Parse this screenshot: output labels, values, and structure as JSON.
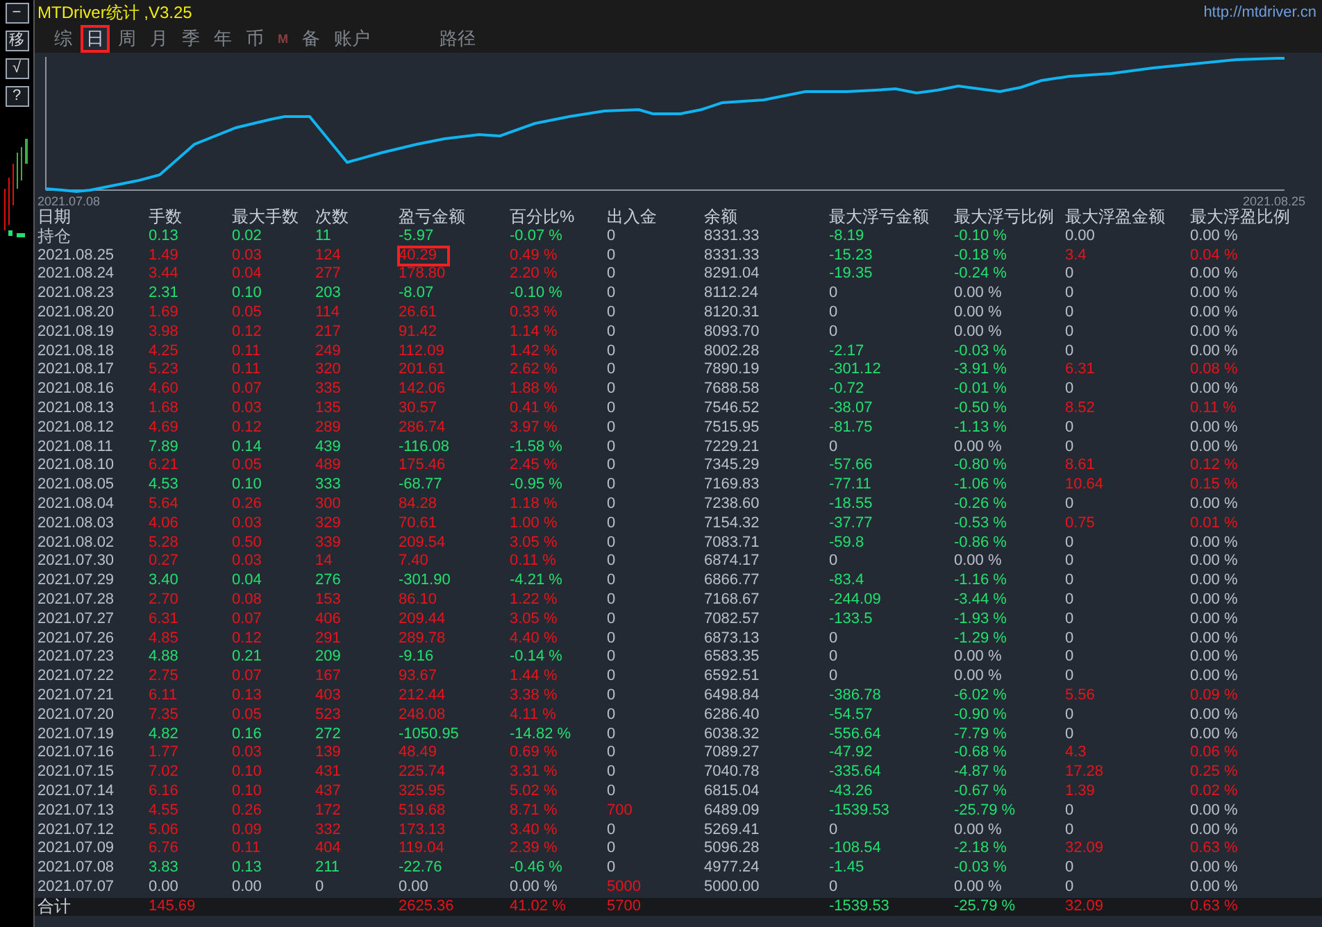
{
  "window": {
    "title": "MTDriver统计 ,V3.25",
    "url": "http://mtdriver.cn"
  },
  "sidebar": {
    "buttons": [
      "−",
      "移",
      "√",
      "?"
    ]
  },
  "tabs": [
    {
      "label": "综",
      "kind": "tab",
      "selected": false
    },
    {
      "label": "日",
      "kind": "tab",
      "selected": true
    },
    {
      "label": "周",
      "kind": "tab",
      "selected": false
    },
    {
      "label": "月",
      "kind": "tab",
      "selected": false
    },
    {
      "label": "季",
      "kind": "tab",
      "selected": false
    },
    {
      "label": "年",
      "kind": "tab",
      "selected": false
    },
    {
      "label": "币",
      "kind": "tab",
      "selected": false
    },
    {
      "label": "M",
      "kind": "mark",
      "selected": false
    },
    {
      "label": "备",
      "kind": "tab",
      "selected": false
    },
    {
      "label": "账户",
      "kind": "tab",
      "selected": false
    },
    {
      "label": "路径",
      "kind": "link",
      "selected": false
    }
  ],
  "chart": {
    "start_label": "2021.07.08",
    "end_label": "2021.08.25"
  },
  "table": {
    "date_column": "日期",
    "columns": [
      "手数",
      "最大手数",
      "次数",
      "盈亏金额",
      "百分比%",
      "出入金",
      "余额",
      "最大浮亏金额",
      "最大浮亏比例",
      "最大浮盈金额",
      "最大浮盈比例"
    ],
    "rows": [
      {
        "date": "持仓",
        "cells": [
          {
            "text": "0.13",
            "color": "#22e06e"
          },
          {
            "text": "0.02",
            "color": "#22e06e"
          },
          {
            "text": "11",
            "color": "#22e06e"
          },
          {
            "text": "-5.97",
            "color": "#22e06e"
          },
          {
            "text": "-0.07 %",
            "color": "#22e06e"
          },
          {
            "text": "0",
            "color": "#b8c0cc"
          },
          {
            "text": "8331.33",
            "color": "#b8c0cc"
          },
          {
            "text": "-8.19",
            "color": "#22e06e"
          },
          {
            "text": "-0.10 %",
            "color": "#22e06e"
          },
          {
            "text": "0.00",
            "color": "#b8c0cc"
          },
          {
            "text": "0.00 %",
            "color": "#b8c0cc"
          }
        ]
      },
      {
        "date": "2021.08.25",
        "cells": [
          {
            "text": "1.49",
            "color": "#e8141c"
          },
          {
            "text": "0.03",
            "color": "#e8141c"
          },
          {
            "text": "124",
            "color": "#e8141c"
          },
          {
            "text": "40.29",
            "color": "#e8141c",
            "outlined": true
          },
          {
            "text": "0.49 %",
            "color": "#e8141c"
          },
          {
            "text": "0",
            "color": "#b8c0cc"
          },
          {
            "text": "8331.33",
            "color": "#b8c0cc"
          },
          {
            "text": "-15.23",
            "color": "#22e06e"
          },
          {
            "text": "-0.18 %",
            "color": "#22e06e"
          },
          {
            "text": "3.4",
            "color": "#e8141c"
          },
          {
            "text": "0.04 %",
            "color": "#e8141c"
          }
        ]
      },
      {
        "date": "2021.08.24",
        "cells": [
          {
            "text": "3.44",
            "color": "#e8141c"
          },
          {
            "text": "0.04",
            "color": "#e8141c"
          },
          {
            "text": "277",
            "color": "#e8141c"
          },
          {
            "text": "178.80",
            "color": "#e8141c"
          },
          {
            "text": "2.20 %",
            "color": "#e8141c"
          },
          {
            "text": "0",
            "color": "#b8c0cc"
          },
          {
            "text": "8291.04",
            "color": "#b8c0cc"
          },
          {
            "text": "-19.35",
            "color": "#22e06e"
          },
          {
            "text": "-0.24 %",
            "color": "#22e06e"
          },
          {
            "text": "0",
            "color": "#b8c0cc"
          },
          {
            "text": "0.00 %",
            "color": "#b8c0cc"
          }
        ]
      },
      {
        "date": "2021.08.23",
        "cells": [
          {
            "text": "2.31",
            "color": "#22e06e"
          },
          {
            "text": "0.10",
            "color": "#22e06e"
          },
          {
            "text": "203",
            "color": "#22e06e"
          },
          {
            "text": "-8.07",
            "color": "#22e06e"
          },
          {
            "text": "-0.10 %",
            "color": "#22e06e"
          },
          {
            "text": "0",
            "color": "#b8c0cc"
          },
          {
            "text": "8112.24",
            "color": "#b8c0cc"
          },
          {
            "text": "0",
            "color": "#b8c0cc"
          },
          {
            "text": "0.00 %",
            "color": "#b8c0cc"
          },
          {
            "text": "0",
            "color": "#b8c0cc"
          },
          {
            "text": "0.00 %",
            "color": "#b8c0cc"
          }
        ]
      },
      {
        "date": "2021.08.20",
        "cells": [
          {
            "text": "1.69",
            "color": "#e8141c"
          },
          {
            "text": "0.05",
            "color": "#e8141c"
          },
          {
            "text": "114",
            "color": "#e8141c"
          },
          {
            "text": "26.61",
            "color": "#e8141c"
          },
          {
            "text": "0.33 %",
            "color": "#e8141c"
          },
          {
            "text": "0",
            "color": "#b8c0cc"
          },
          {
            "text": "8120.31",
            "color": "#b8c0cc"
          },
          {
            "text": "0",
            "color": "#b8c0cc"
          },
          {
            "text": "0.00 %",
            "color": "#b8c0cc"
          },
          {
            "text": "0",
            "color": "#b8c0cc"
          },
          {
            "text": "0.00 %",
            "color": "#b8c0cc"
          }
        ]
      },
      {
        "date": "2021.08.19",
        "cells": [
          {
            "text": "3.98",
            "color": "#e8141c"
          },
          {
            "text": "0.12",
            "color": "#e8141c"
          },
          {
            "text": "217",
            "color": "#e8141c"
          },
          {
            "text": "91.42",
            "color": "#e8141c"
          },
          {
            "text": "1.14 %",
            "color": "#e8141c"
          },
          {
            "text": "0",
            "color": "#b8c0cc"
          },
          {
            "text": "8093.70",
            "color": "#b8c0cc"
          },
          {
            "text": "0",
            "color": "#b8c0cc"
          },
          {
            "text": "0.00 %",
            "color": "#b8c0cc"
          },
          {
            "text": "0",
            "color": "#b8c0cc"
          },
          {
            "text": "0.00 %",
            "color": "#b8c0cc"
          }
        ]
      },
      {
        "date": "2021.08.18",
        "cells": [
          {
            "text": "4.25",
            "color": "#e8141c"
          },
          {
            "text": "0.11",
            "color": "#e8141c"
          },
          {
            "text": "249",
            "color": "#e8141c"
          },
          {
            "text": "112.09",
            "color": "#e8141c"
          },
          {
            "text": "1.42 %",
            "color": "#e8141c"
          },
          {
            "text": "0",
            "color": "#b8c0cc"
          },
          {
            "text": "8002.28",
            "color": "#b8c0cc"
          },
          {
            "text": "-2.17",
            "color": "#22e06e"
          },
          {
            "text": "-0.03 %",
            "color": "#22e06e"
          },
          {
            "text": "0",
            "color": "#b8c0cc"
          },
          {
            "text": "0.00 %",
            "color": "#b8c0cc"
          }
        ]
      },
      {
        "date": "2021.08.17",
        "cells": [
          {
            "text": "5.23",
            "color": "#e8141c"
          },
          {
            "text": "0.11",
            "color": "#e8141c"
          },
          {
            "text": "320",
            "color": "#e8141c"
          },
          {
            "text": "201.61",
            "color": "#e8141c"
          },
          {
            "text": "2.62 %",
            "color": "#e8141c"
          },
          {
            "text": "0",
            "color": "#b8c0cc"
          },
          {
            "text": "7890.19",
            "color": "#b8c0cc"
          },
          {
            "text": "-301.12",
            "color": "#22e06e"
          },
          {
            "text": "-3.91 %",
            "color": "#22e06e"
          },
          {
            "text": "6.31",
            "color": "#e8141c"
          },
          {
            "text": "0.08 %",
            "color": "#e8141c"
          }
        ]
      },
      {
        "date": "2021.08.16",
        "cells": [
          {
            "text": "4.60",
            "color": "#e8141c"
          },
          {
            "text": "0.07",
            "color": "#e8141c"
          },
          {
            "text": "335",
            "color": "#e8141c"
          },
          {
            "text": "142.06",
            "color": "#e8141c"
          },
          {
            "text": "1.88 %",
            "color": "#e8141c"
          },
          {
            "text": "0",
            "color": "#b8c0cc"
          },
          {
            "text": "7688.58",
            "color": "#b8c0cc"
          },
          {
            "text": "-0.72",
            "color": "#22e06e"
          },
          {
            "text": "-0.01 %",
            "color": "#22e06e"
          },
          {
            "text": "0",
            "color": "#b8c0cc"
          },
          {
            "text": "0.00 %",
            "color": "#b8c0cc"
          }
        ]
      },
      {
        "date": "2021.08.13",
        "cells": [
          {
            "text": "1.68",
            "color": "#e8141c"
          },
          {
            "text": "0.03",
            "color": "#e8141c"
          },
          {
            "text": "135",
            "color": "#e8141c"
          },
          {
            "text": "30.57",
            "color": "#e8141c"
          },
          {
            "text": "0.41 %",
            "color": "#e8141c"
          },
          {
            "text": "0",
            "color": "#b8c0cc"
          },
          {
            "text": "7546.52",
            "color": "#b8c0cc"
          },
          {
            "text": "-38.07",
            "color": "#22e06e"
          },
          {
            "text": "-0.50 %",
            "color": "#22e06e"
          },
          {
            "text": "8.52",
            "color": "#e8141c"
          },
          {
            "text": "0.11 %",
            "color": "#e8141c"
          }
        ]
      },
      {
        "date": "2021.08.12",
        "cells": [
          {
            "text": "4.69",
            "color": "#e8141c"
          },
          {
            "text": "0.12",
            "color": "#e8141c"
          },
          {
            "text": "289",
            "color": "#e8141c"
          },
          {
            "text": "286.74",
            "color": "#e8141c"
          },
          {
            "text": "3.97 %",
            "color": "#e8141c"
          },
          {
            "text": "0",
            "color": "#b8c0cc"
          },
          {
            "text": "7515.95",
            "color": "#b8c0cc"
          },
          {
            "text": "-81.75",
            "color": "#22e06e"
          },
          {
            "text": "-1.13 %",
            "color": "#22e06e"
          },
          {
            "text": "0",
            "color": "#b8c0cc"
          },
          {
            "text": "0.00 %",
            "color": "#b8c0cc"
          }
        ]
      },
      {
        "date": "2021.08.11",
        "cells": [
          {
            "text": "7.89",
            "color": "#22e06e"
          },
          {
            "text": "0.14",
            "color": "#22e06e"
          },
          {
            "text": "439",
            "color": "#22e06e"
          },
          {
            "text": "-116.08",
            "color": "#22e06e"
          },
          {
            "text": "-1.58 %",
            "color": "#22e06e"
          },
          {
            "text": "0",
            "color": "#b8c0cc"
          },
          {
            "text": "7229.21",
            "color": "#b8c0cc"
          },
          {
            "text": "0",
            "color": "#b8c0cc"
          },
          {
            "text": "0.00 %",
            "color": "#b8c0cc"
          },
          {
            "text": "0",
            "color": "#b8c0cc"
          },
          {
            "text": "0.00 %",
            "color": "#b8c0cc"
          }
        ]
      },
      {
        "date": "2021.08.10",
        "cells": [
          {
            "text": "6.21",
            "color": "#e8141c"
          },
          {
            "text": "0.05",
            "color": "#e8141c"
          },
          {
            "text": "489",
            "color": "#e8141c"
          },
          {
            "text": "175.46",
            "color": "#e8141c"
          },
          {
            "text": "2.45 %",
            "color": "#e8141c"
          },
          {
            "text": "0",
            "color": "#b8c0cc"
          },
          {
            "text": "7345.29",
            "color": "#b8c0cc"
          },
          {
            "text": "-57.66",
            "color": "#22e06e"
          },
          {
            "text": "-0.80 %",
            "color": "#22e06e"
          },
          {
            "text": "8.61",
            "color": "#e8141c"
          },
          {
            "text": "0.12 %",
            "color": "#e8141c"
          }
        ]
      },
      {
        "date": "2021.08.05",
        "cells": [
          {
            "text": "4.53",
            "color": "#22e06e"
          },
          {
            "text": "0.10",
            "color": "#22e06e"
          },
          {
            "text": "333",
            "color": "#22e06e"
          },
          {
            "text": "-68.77",
            "color": "#22e06e"
          },
          {
            "text": "-0.95 %",
            "color": "#22e06e"
          },
          {
            "text": "0",
            "color": "#b8c0cc"
          },
          {
            "text": "7169.83",
            "color": "#b8c0cc"
          },
          {
            "text": "-77.11",
            "color": "#22e06e"
          },
          {
            "text": "-1.06 %",
            "color": "#22e06e"
          },
          {
            "text": "10.64",
            "color": "#e8141c"
          },
          {
            "text": "0.15 %",
            "color": "#e8141c"
          }
        ]
      },
      {
        "date": "2021.08.04",
        "cells": [
          {
            "text": "5.64",
            "color": "#e8141c"
          },
          {
            "text": "0.26",
            "color": "#e8141c"
          },
          {
            "text": "300",
            "color": "#e8141c"
          },
          {
            "text": "84.28",
            "color": "#e8141c"
          },
          {
            "text": "1.18 %",
            "color": "#e8141c"
          },
          {
            "text": "0",
            "color": "#b8c0cc"
          },
          {
            "text": "7238.60",
            "color": "#b8c0cc"
          },
          {
            "text": "-18.55",
            "color": "#22e06e"
          },
          {
            "text": "-0.26 %",
            "color": "#22e06e"
          },
          {
            "text": "0",
            "color": "#b8c0cc"
          },
          {
            "text": "0.00 %",
            "color": "#b8c0cc"
          }
        ]
      },
      {
        "date": "2021.08.03",
        "cells": [
          {
            "text": "4.06",
            "color": "#e8141c"
          },
          {
            "text": "0.03",
            "color": "#e8141c"
          },
          {
            "text": "329",
            "color": "#e8141c"
          },
          {
            "text": "70.61",
            "color": "#e8141c"
          },
          {
            "text": "1.00 %",
            "color": "#e8141c"
          },
          {
            "text": "0",
            "color": "#b8c0cc"
          },
          {
            "text": "7154.32",
            "color": "#b8c0cc"
          },
          {
            "text": "-37.77",
            "color": "#22e06e"
          },
          {
            "text": "-0.53 %",
            "color": "#22e06e"
          },
          {
            "text": "0.75",
            "color": "#e8141c"
          },
          {
            "text": "0.01 %",
            "color": "#e8141c"
          }
        ]
      },
      {
        "date": "2021.08.02",
        "cells": [
          {
            "text": "5.28",
            "color": "#e8141c"
          },
          {
            "text": "0.50",
            "color": "#e8141c"
          },
          {
            "text": "339",
            "color": "#e8141c"
          },
          {
            "text": "209.54",
            "color": "#e8141c"
          },
          {
            "text": "3.05 %",
            "color": "#e8141c"
          },
          {
            "text": "0",
            "color": "#b8c0cc"
          },
          {
            "text": "7083.71",
            "color": "#b8c0cc"
          },
          {
            "text": "-59.8",
            "color": "#22e06e"
          },
          {
            "text": "-0.86 %",
            "color": "#22e06e"
          },
          {
            "text": "0",
            "color": "#b8c0cc"
          },
          {
            "text": "0.00 %",
            "color": "#b8c0cc"
          }
        ]
      },
      {
        "date": "2021.07.30",
        "cells": [
          {
            "text": "0.27",
            "color": "#e8141c"
          },
          {
            "text": "0.03",
            "color": "#e8141c"
          },
          {
            "text": "14",
            "color": "#e8141c"
          },
          {
            "text": "7.40",
            "color": "#e8141c"
          },
          {
            "text": "0.11 %",
            "color": "#e8141c"
          },
          {
            "text": "0",
            "color": "#b8c0cc"
          },
          {
            "text": "6874.17",
            "color": "#b8c0cc"
          },
          {
            "text": "0",
            "color": "#b8c0cc"
          },
          {
            "text": "0.00 %",
            "color": "#b8c0cc"
          },
          {
            "text": "0",
            "color": "#b8c0cc"
          },
          {
            "text": "0.00 %",
            "color": "#b8c0cc"
          }
        ]
      },
      {
        "date": "2021.07.29",
        "cells": [
          {
            "text": "3.40",
            "color": "#22e06e"
          },
          {
            "text": "0.04",
            "color": "#22e06e"
          },
          {
            "text": "276",
            "color": "#22e06e"
          },
          {
            "text": "-301.90",
            "color": "#22e06e"
          },
          {
            "text": "-4.21 %",
            "color": "#22e06e"
          },
          {
            "text": "0",
            "color": "#b8c0cc"
          },
          {
            "text": "6866.77",
            "color": "#b8c0cc"
          },
          {
            "text": "-83.4",
            "color": "#22e06e"
          },
          {
            "text": "-1.16 %",
            "color": "#22e06e"
          },
          {
            "text": "0",
            "color": "#b8c0cc"
          },
          {
            "text": "0.00 %",
            "color": "#b8c0cc"
          }
        ]
      },
      {
        "date": "2021.07.28",
        "cells": [
          {
            "text": "2.70",
            "color": "#e8141c"
          },
          {
            "text": "0.08",
            "color": "#e8141c"
          },
          {
            "text": "153",
            "color": "#e8141c"
          },
          {
            "text": "86.10",
            "color": "#e8141c"
          },
          {
            "text": "1.22 %",
            "color": "#e8141c"
          },
          {
            "text": "0",
            "color": "#b8c0cc"
          },
          {
            "text": "7168.67",
            "color": "#b8c0cc"
          },
          {
            "text": "-244.09",
            "color": "#22e06e"
          },
          {
            "text": "-3.44 %",
            "color": "#22e06e"
          },
          {
            "text": "0",
            "color": "#b8c0cc"
          },
          {
            "text": "0.00 %",
            "color": "#b8c0cc"
          }
        ]
      },
      {
        "date": "2021.07.27",
        "cells": [
          {
            "text": "6.31",
            "color": "#e8141c"
          },
          {
            "text": "0.07",
            "color": "#e8141c"
          },
          {
            "text": "406",
            "color": "#e8141c"
          },
          {
            "text": "209.44",
            "color": "#e8141c"
          },
          {
            "text": "3.05 %",
            "color": "#e8141c"
          },
          {
            "text": "0",
            "color": "#b8c0cc"
          },
          {
            "text": "7082.57",
            "color": "#b8c0cc"
          },
          {
            "text": "-133.5",
            "color": "#22e06e"
          },
          {
            "text": "-1.93 %",
            "color": "#22e06e"
          },
          {
            "text": "0",
            "color": "#b8c0cc"
          },
          {
            "text": "0.00 %",
            "color": "#b8c0cc"
          }
        ]
      },
      {
        "date": "2021.07.26",
        "cells": [
          {
            "text": "4.85",
            "color": "#e8141c"
          },
          {
            "text": "0.12",
            "color": "#e8141c"
          },
          {
            "text": "291",
            "color": "#e8141c"
          },
          {
            "text": "289.78",
            "color": "#e8141c"
          },
          {
            "text": "4.40 %",
            "color": "#e8141c"
          },
          {
            "text": "0",
            "color": "#b8c0cc"
          },
          {
            "text": "6873.13",
            "color": "#b8c0cc"
          },
          {
            "text": "0",
            "color": "#b8c0cc"
          },
          {
            "text": "-1.29 %",
            "color": "#22e06e"
          },
          {
            "text": "0",
            "color": "#b8c0cc"
          },
          {
            "text": "0.00 %",
            "color": "#b8c0cc"
          }
        ]
      },
      {
        "date": "2021.07.23",
        "cells": [
          {
            "text": "4.88",
            "color": "#22e06e"
          },
          {
            "text": "0.21",
            "color": "#22e06e"
          },
          {
            "text": "209",
            "color": "#22e06e"
          },
          {
            "text": "-9.16",
            "color": "#22e06e"
          },
          {
            "text": "-0.14 %",
            "color": "#22e06e"
          },
          {
            "text": "0",
            "color": "#b8c0cc"
          },
          {
            "text": "6583.35",
            "color": "#b8c0cc"
          },
          {
            "text": "0",
            "color": "#b8c0cc"
          },
          {
            "text": "0.00 %",
            "color": "#b8c0cc"
          },
          {
            "text": "0",
            "color": "#b8c0cc"
          },
          {
            "text": "0.00 %",
            "color": "#b8c0cc"
          }
        ]
      },
      {
        "date": "2021.07.22",
        "cells": [
          {
            "text": "2.75",
            "color": "#e8141c"
          },
          {
            "text": "0.07",
            "color": "#e8141c"
          },
          {
            "text": "167",
            "color": "#e8141c"
          },
          {
            "text": "93.67",
            "color": "#e8141c"
          },
          {
            "text": "1.44 %",
            "color": "#e8141c"
          },
          {
            "text": "0",
            "color": "#b8c0cc"
          },
          {
            "text": "6592.51",
            "color": "#b8c0cc"
          },
          {
            "text": "0",
            "color": "#b8c0cc"
          },
          {
            "text": "0.00 %",
            "color": "#b8c0cc"
          },
          {
            "text": "0",
            "color": "#b8c0cc"
          },
          {
            "text": "0.00 %",
            "color": "#b8c0cc"
          }
        ]
      },
      {
        "date": "2021.07.21",
        "cells": [
          {
            "text": "6.11",
            "color": "#e8141c"
          },
          {
            "text": "0.13",
            "color": "#e8141c"
          },
          {
            "text": "403",
            "color": "#e8141c"
          },
          {
            "text": "212.44",
            "color": "#e8141c"
          },
          {
            "text": "3.38 %",
            "color": "#e8141c"
          },
          {
            "text": "0",
            "color": "#b8c0cc"
          },
          {
            "text": "6498.84",
            "color": "#b8c0cc"
          },
          {
            "text": "-386.78",
            "color": "#22e06e"
          },
          {
            "text": "-6.02 %",
            "color": "#22e06e"
          },
          {
            "text": "5.56",
            "color": "#e8141c"
          },
          {
            "text": "0.09 %",
            "color": "#e8141c"
          }
        ]
      },
      {
        "date": "2021.07.20",
        "cells": [
          {
            "text": "7.35",
            "color": "#e8141c"
          },
          {
            "text": "0.05",
            "color": "#e8141c"
          },
          {
            "text": "523",
            "color": "#e8141c"
          },
          {
            "text": "248.08",
            "color": "#e8141c"
          },
          {
            "text": "4.11 %",
            "color": "#e8141c"
          },
          {
            "text": "0",
            "color": "#b8c0cc"
          },
          {
            "text": "6286.40",
            "color": "#b8c0cc"
          },
          {
            "text": "-54.57",
            "color": "#22e06e"
          },
          {
            "text": "-0.90 %",
            "color": "#22e06e"
          },
          {
            "text": "0",
            "color": "#b8c0cc"
          },
          {
            "text": "0.00 %",
            "color": "#b8c0cc"
          }
        ]
      },
      {
        "date": "2021.07.19",
        "cells": [
          {
            "text": "4.82",
            "color": "#22e06e"
          },
          {
            "text": "0.16",
            "color": "#22e06e"
          },
          {
            "text": "272",
            "color": "#22e06e"
          },
          {
            "text": "-1050.95",
            "color": "#22e06e"
          },
          {
            "text": "-14.82 %",
            "color": "#22e06e"
          },
          {
            "text": "0",
            "color": "#b8c0cc"
          },
          {
            "text": "6038.32",
            "color": "#b8c0cc"
          },
          {
            "text": "-556.64",
            "color": "#22e06e"
          },
          {
            "text": "-7.79 %",
            "color": "#22e06e"
          },
          {
            "text": "0",
            "color": "#b8c0cc"
          },
          {
            "text": "0.00 %",
            "color": "#b8c0cc"
          }
        ]
      },
      {
        "date": "2021.07.16",
        "cells": [
          {
            "text": "1.77",
            "color": "#e8141c"
          },
          {
            "text": "0.03",
            "color": "#e8141c"
          },
          {
            "text": "139",
            "color": "#e8141c"
          },
          {
            "text": "48.49",
            "color": "#e8141c"
          },
          {
            "text": "0.69 %",
            "color": "#e8141c"
          },
          {
            "text": "0",
            "color": "#b8c0cc"
          },
          {
            "text": "7089.27",
            "color": "#b8c0cc"
          },
          {
            "text": "-47.92",
            "color": "#22e06e"
          },
          {
            "text": "-0.68 %",
            "color": "#22e06e"
          },
          {
            "text": "4.3",
            "color": "#e8141c"
          },
          {
            "text": "0.06 %",
            "color": "#e8141c"
          }
        ]
      },
      {
        "date": "2021.07.15",
        "cells": [
          {
            "text": "7.02",
            "color": "#e8141c"
          },
          {
            "text": "0.10",
            "color": "#e8141c"
          },
          {
            "text": "431",
            "color": "#e8141c"
          },
          {
            "text": "225.74",
            "color": "#e8141c"
          },
          {
            "text": "3.31 %",
            "color": "#e8141c"
          },
          {
            "text": "0",
            "color": "#b8c0cc"
          },
          {
            "text": "7040.78",
            "color": "#b8c0cc"
          },
          {
            "text": "-335.64",
            "color": "#22e06e"
          },
          {
            "text": "-4.87 %",
            "color": "#22e06e"
          },
          {
            "text": "17.28",
            "color": "#e8141c"
          },
          {
            "text": "0.25 %",
            "color": "#e8141c"
          }
        ]
      },
      {
        "date": "2021.07.14",
        "cells": [
          {
            "text": "6.16",
            "color": "#e8141c"
          },
          {
            "text": "0.10",
            "color": "#e8141c"
          },
          {
            "text": "437",
            "color": "#e8141c"
          },
          {
            "text": "325.95",
            "color": "#e8141c"
          },
          {
            "text": "5.02 %",
            "color": "#e8141c"
          },
          {
            "text": "0",
            "color": "#b8c0cc"
          },
          {
            "text": "6815.04",
            "color": "#b8c0cc"
          },
          {
            "text": "-43.26",
            "color": "#22e06e"
          },
          {
            "text": "-0.67 %",
            "color": "#22e06e"
          },
          {
            "text": "1.39",
            "color": "#e8141c"
          },
          {
            "text": "0.02 %",
            "color": "#e8141c"
          }
        ]
      },
      {
        "date": "2021.07.13",
        "cells": [
          {
            "text": "4.55",
            "color": "#e8141c"
          },
          {
            "text": "0.26",
            "color": "#e8141c"
          },
          {
            "text": "172",
            "color": "#e8141c"
          },
          {
            "text": "519.68",
            "color": "#e8141c"
          },
          {
            "text": "8.71 %",
            "color": "#e8141c"
          },
          {
            "text": "700",
            "color": "#e8141c"
          },
          {
            "text": "6489.09",
            "color": "#b8c0cc"
          },
          {
            "text": "-1539.53",
            "color": "#22e06e"
          },
          {
            "text": "-25.79 %",
            "color": "#22e06e"
          },
          {
            "text": "0",
            "color": "#b8c0cc"
          },
          {
            "text": "0.00 %",
            "color": "#b8c0cc"
          }
        ]
      },
      {
        "date": "2021.07.12",
        "cells": [
          {
            "text": "5.06",
            "color": "#e8141c"
          },
          {
            "text": "0.09",
            "color": "#e8141c"
          },
          {
            "text": "332",
            "color": "#e8141c"
          },
          {
            "text": "173.13",
            "color": "#e8141c"
          },
          {
            "text": "3.40 %",
            "color": "#e8141c"
          },
          {
            "text": "0",
            "color": "#b8c0cc"
          },
          {
            "text": "5269.41",
            "color": "#b8c0cc"
          },
          {
            "text": "0",
            "color": "#b8c0cc"
          },
          {
            "text": "0.00 %",
            "color": "#b8c0cc"
          },
          {
            "text": "0",
            "color": "#b8c0cc"
          },
          {
            "text": "0.00 %",
            "color": "#b8c0cc"
          }
        ]
      },
      {
        "date": "2021.07.09",
        "cells": [
          {
            "text": "6.76",
            "color": "#e8141c"
          },
          {
            "text": "0.11",
            "color": "#e8141c"
          },
          {
            "text": "404",
            "color": "#e8141c"
          },
          {
            "text": "119.04",
            "color": "#e8141c"
          },
          {
            "text": "2.39 %",
            "color": "#e8141c"
          },
          {
            "text": "0",
            "color": "#b8c0cc"
          },
          {
            "text": "5096.28",
            "color": "#b8c0cc"
          },
          {
            "text": "-108.54",
            "color": "#22e06e"
          },
          {
            "text": "-2.18 %",
            "color": "#22e06e"
          },
          {
            "text": "32.09",
            "color": "#e8141c"
          },
          {
            "text": "0.63 %",
            "color": "#e8141c"
          }
        ]
      },
      {
        "date": "2021.07.08",
        "cells": [
          {
            "text": "3.83",
            "color": "#22e06e"
          },
          {
            "text": "0.13",
            "color": "#22e06e"
          },
          {
            "text": "211",
            "color": "#22e06e"
          },
          {
            "text": "-22.76",
            "color": "#22e06e"
          },
          {
            "text": "-0.46 %",
            "color": "#22e06e"
          },
          {
            "text": "0",
            "color": "#b8c0cc"
          },
          {
            "text": "4977.24",
            "color": "#b8c0cc"
          },
          {
            "text": "-1.45",
            "color": "#22e06e"
          },
          {
            "text": "-0.03 %",
            "color": "#22e06e"
          },
          {
            "text": "0",
            "color": "#b8c0cc"
          },
          {
            "text": "0.00 %",
            "color": "#b8c0cc"
          }
        ]
      },
      {
        "date": "2021.07.07",
        "cells": [
          {
            "text": "0.00",
            "color": "#b8c0cc"
          },
          {
            "text": "0.00",
            "color": "#b8c0cc"
          },
          {
            "text": "0",
            "color": "#b8c0cc"
          },
          {
            "text": "0.00",
            "color": "#b8c0cc"
          },
          {
            "text": "0.00 %",
            "color": "#b8c0cc"
          },
          {
            "text": "5000",
            "color": "#e8141c"
          },
          {
            "text": "5000.00",
            "color": "#b8c0cc"
          },
          {
            "text": "0",
            "color": "#b8c0cc"
          },
          {
            "text": "0.00 %",
            "color": "#b8c0cc"
          },
          {
            "text": "0",
            "color": "#b8c0cc"
          },
          {
            "text": "0.00 %",
            "color": "#b8c0cc"
          }
        ]
      }
    ],
    "total": {
      "label": "合计",
      "lots": {
        "text": "145.69",
        "color": "#e8141c"
      },
      "amount": {
        "text": "2625.36",
        "color": "#e8141c"
      },
      "percent": {
        "text": "41.02 %",
        "color": "#e8141c"
      },
      "transfer": {
        "text": "5700",
        "color": "#e8141c"
      },
      "max_float_loss": {
        "text": "-1539.53",
        "color": "#22e06e"
      },
      "max_float_loss_ratio": {
        "text": "-25.79 %",
        "color": "#22e06e"
      },
      "max_float_profit": {
        "text": "32.09",
        "color": "#e8141c"
      },
      "max_float_profit_ratio": {
        "text": "0.63 %",
        "color": "#e8141c"
      }
    }
  }
}
